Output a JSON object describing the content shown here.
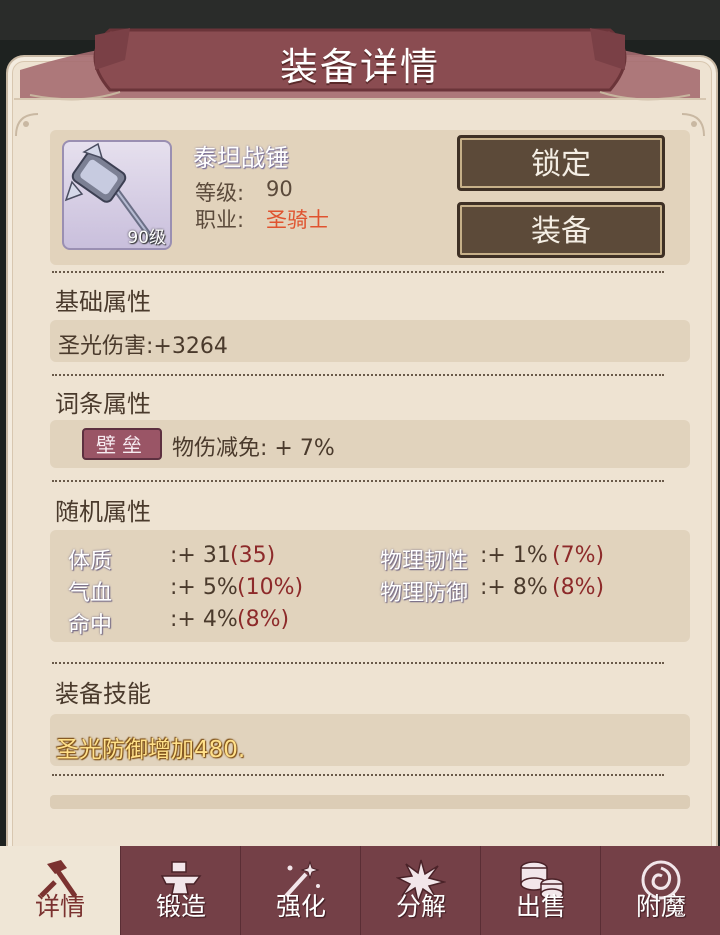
{
  "window": {
    "title": "装备详情"
  },
  "item": {
    "name": "泰坦战锤",
    "level_badge": "90级",
    "level_label": "等级:",
    "level_value": "90",
    "class_label": "职业:",
    "class_value": "圣骑士"
  },
  "buttons": {
    "lock": "锁定",
    "equip": "装备"
  },
  "sections": {
    "basic": {
      "title": "基础属性",
      "text": "圣光伤害:+3264"
    },
    "affix": {
      "title": "词条属性",
      "tag": "壁垒",
      "text": "物伤减免: + 7%"
    },
    "random": {
      "title": "随机属性",
      "stats": [
        {
          "name": "体质",
          "value": ":+ 31",
          "max": "(35)"
        },
        {
          "name": "气血",
          "value": ":+ 5%",
          "max": "(10%)"
        },
        {
          "name": "命中",
          "value": ":+ 4%",
          "max": "(8%)"
        },
        {
          "name": "物理韧性",
          "value": ":+ 1%",
          "max": "(7%)"
        },
        {
          "name": "物理防御",
          "value": ":+ 8%",
          "max": "(8%)"
        }
      ]
    },
    "skill": {
      "title": "装备技能",
      "text": "圣光防御增加480."
    }
  },
  "tabs": [
    {
      "label": "详情",
      "icon": "hammer-icon",
      "active": true
    },
    {
      "label": "锻造",
      "icon": "anvil-icon",
      "active": false
    },
    {
      "label": "强化",
      "icon": "sparkle-wand-icon",
      "active": false
    },
    {
      "label": "分解",
      "icon": "explosion-icon",
      "active": false
    },
    {
      "label": "出售",
      "icon": "coins-icon",
      "active": false
    },
    {
      "label": "附魔",
      "icon": "magic-swirl-icon",
      "active": false
    }
  ],
  "colors": {
    "panel_bg": "#eee3d2",
    "banner": "#8a4c51",
    "button_bg": "#5c4a39",
    "tab_bg": "#744047",
    "class_red": "#e0532f",
    "stat_max_red": "#8d2a2a",
    "skill_gold": "#ffe08a"
  }
}
